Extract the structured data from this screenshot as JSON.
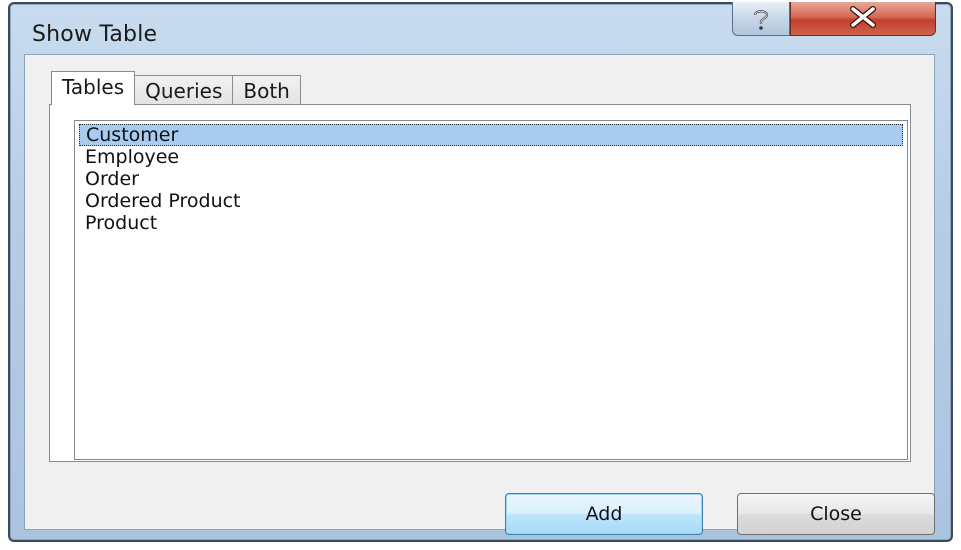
{
  "window": {
    "title": "Show Table",
    "help_icon": "help-question-icon",
    "close_icon": "close-x-icon"
  },
  "tabs": [
    {
      "label": "Tables",
      "active": true
    },
    {
      "label": "Queries",
      "active": false
    },
    {
      "label": "Both",
      "active": false
    }
  ],
  "list": {
    "items": [
      "Customer",
      "Employee",
      "Order",
      "Ordered Product",
      "Product"
    ],
    "selected": "Customer"
  },
  "buttons": {
    "add_label": "Add",
    "close_label": "Close"
  },
  "colors": {
    "selection": "#a8cbf0",
    "close_button": "#c0402b",
    "default_button": "#bee6fd"
  }
}
